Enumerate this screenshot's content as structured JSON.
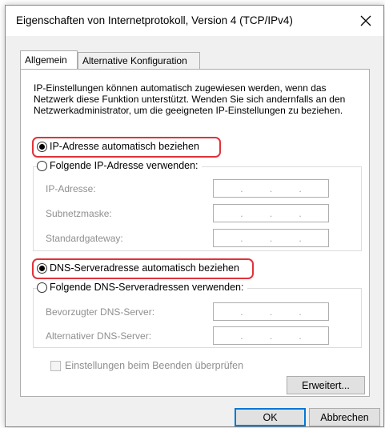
{
  "window": {
    "title": "Eigenschaften von Internetprotokoll, Version 4 (TCP/IPv4)",
    "close_icon": "close-icon"
  },
  "tabs": [
    {
      "label": "Allgemein",
      "active": true
    },
    {
      "label": "Alternative Konfiguration",
      "active": false
    }
  ],
  "intro_text": "IP-Einstellungen können automatisch zugewiesen werden, wenn das Netzwerk diese Funktion unterstützt. Wenden Sie sich andernfalls an den Netzwerkadministrator, um die geeigneten IP-Einstellungen zu beziehen.",
  "ip": {
    "auto_label": "IP-Adresse automatisch beziehen",
    "auto_selected": true,
    "manual_label": "Folgende IP-Adresse verwenden:",
    "manual_selected": false,
    "fields": [
      {
        "label": "IP-Adresse:",
        "value": ". . ."
      },
      {
        "label": "Subnetzmaske:",
        "value": ". . ."
      },
      {
        "label": "Standardgateway:",
        "value": ". . ."
      }
    ]
  },
  "dns": {
    "auto_label": "DNS-Serveradresse automatisch beziehen",
    "auto_selected": true,
    "manual_label": "Folgende DNS-Serveradressen verwenden:",
    "manual_selected": false,
    "fields": [
      {
        "label": "Bevorzugter DNS-Server:",
        "value": ". . ."
      },
      {
        "label": "Alternativer DNS-Server:",
        "value": ". . ."
      }
    ]
  },
  "validate_checkbox": {
    "label": "Einstellungen beim Beenden überprüfen",
    "checked": false,
    "enabled": false
  },
  "buttons": {
    "advanced": "Erweitert...",
    "ok": "OK",
    "cancel": "Abbrechen"
  },
  "colors": {
    "highlight": "#e0333b",
    "default_button": "#0078d7"
  }
}
